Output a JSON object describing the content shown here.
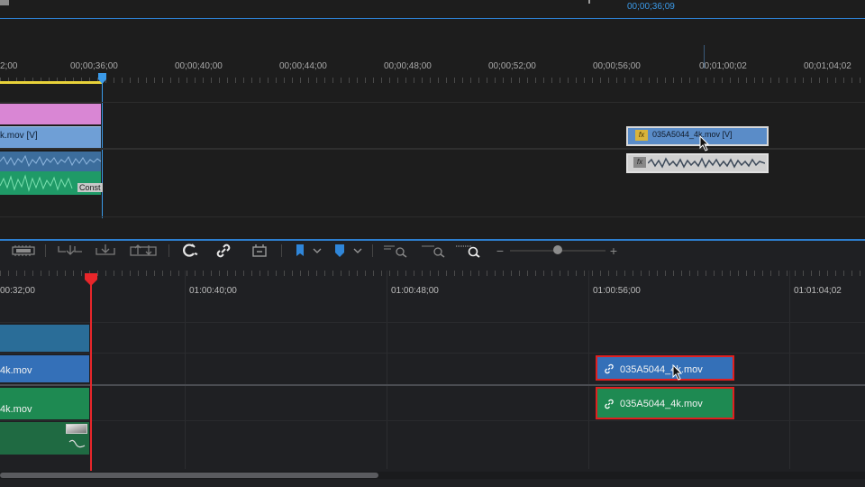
{
  "top_panel": {
    "current_time": "00;00;36;09",
    "ruler_ticks": [
      "2;00",
      "00;00;36;00",
      "00;00;40;00",
      "00;00;44;00",
      "00;00;48;00",
      "00;00;52;00",
      "00;00;56;00",
      "00;01;00;02",
      "00;01;04;02"
    ],
    "left_clip_video_label": "k.mov [V]",
    "left_clip_audio_label": "Const",
    "right_clip_video_label": "035A5044_4k.mov [V]",
    "right_clip_fx_badge": "fx",
    "right_clip_audio_badge": "fx"
  },
  "toolbar": {
    "tools": [
      {
        "icon": "multicam-icon"
      },
      {
        "icon": "insert-icon"
      },
      {
        "icon": "overwrite-icon"
      },
      {
        "icon": "lift-extract-icon"
      },
      {
        "icon": "snap-icon"
      },
      {
        "icon": "linked-selection-icon"
      },
      {
        "icon": "track-select-icon"
      },
      {
        "icon": "add-marker-icon"
      },
      {
        "icon": "marker-dropdown-icon"
      },
      {
        "icon": "shield-marker-icon"
      },
      {
        "icon": "shield-dropdown-icon"
      },
      {
        "icon": "zoom-out-icon"
      },
      {
        "icon": "zoom-fit-icon"
      },
      {
        "icon": "zoom-in-icon"
      }
    ],
    "zoom_minus": "−",
    "zoom_plus": "+",
    "zoom_level": 0.5
  },
  "timeline": {
    "ruler_ticks": [
      "00:32;00",
      "01:00:40;00",
      "01:00:48;00",
      "01:00:56;00",
      "01:01:04;02"
    ],
    "left_video_clip_label": "4k.mov",
    "left_audio_clip_label": "4k.mov",
    "selected_video_clip_label": "035A5044_4k.mov",
    "selected_audio_clip_label": "035A5044_4k.mov"
  },
  "colors": {
    "accent_blue": "#3b9ae8",
    "playhead_red": "#e8262a",
    "selection_red": "#e01f1f",
    "video_clip_blue": "#3470b8",
    "audio_clip_green": "#1e8a52",
    "pink_clip": "#d986d4"
  }
}
